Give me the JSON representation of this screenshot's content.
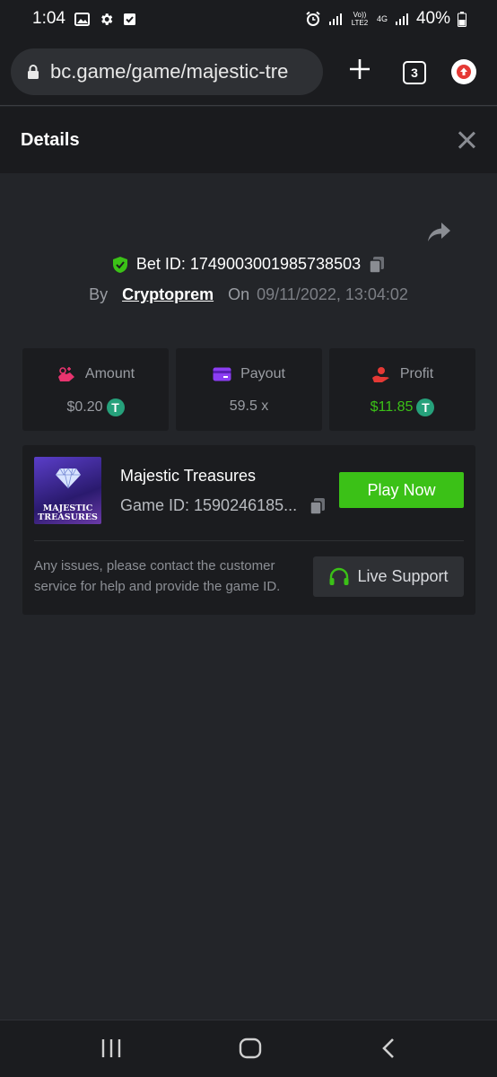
{
  "status_bar": {
    "time": "1:04",
    "battery": "40%",
    "network_labels": [
      "Vo)) LTE2",
      "4G"
    ]
  },
  "browser": {
    "url": "bc.game/game/majestic-tre",
    "tab_count": "3"
  },
  "header": {
    "title": "Details"
  },
  "bet": {
    "bet_id_label": "Bet ID: 1749003001985738503",
    "by_label": "By",
    "username": "Cryptoprem",
    "on_label": "On",
    "date": "09/11/2022, 13:04:02"
  },
  "stats": {
    "amount": {
      "label": "Amount",
      "value": "$0.20",
      "currency_icon": "T"
    },
    "payout": {
      "label": "Payout",
      "value": "59.5 x"
    },
    "profit": {
      "label": "Profit",
      "value": "$11.85",
      "currency_icon": "T",
      "color": "#3bc117"
    }
  },
  "game": {
    "thumb_line1": "MAJESTIC",
    "thumb_line2": "TREASURES",
    "name": "Majestic Treasures",
    "game_id": "Game ID: 1590246185...",
    "play_label": "Play Now"
  },
  "support": {
    "note": "Any issues, please contact the customer service for help and provide the game ID.",
    "button_label": "Live Support"
  },
  "colors": {
    "accent_green": "#3bc117",
    "background": "#232529",
    "card": "#1b1c1f"
  }
}
